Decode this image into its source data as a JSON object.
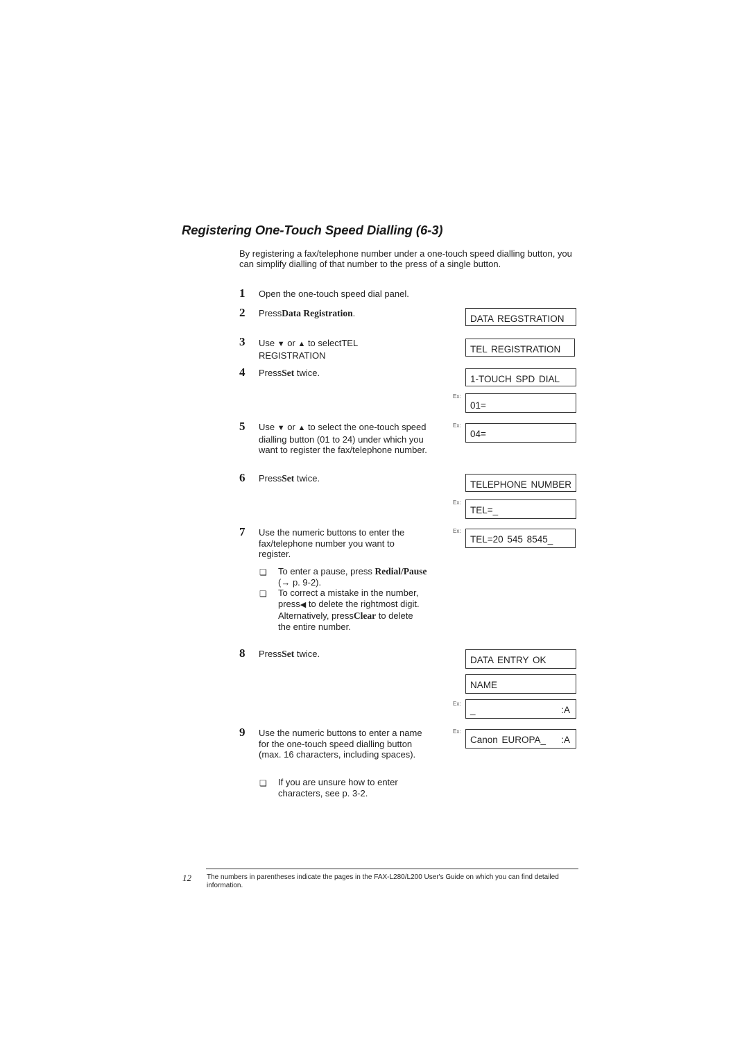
{
  "section": {
    "title": "Registering One-Touch Speed Dialling (6-3)",
    "intro": "By registering a fax/telephone number under a one-touch speed dialling button, you can simplify dialling of that number to the press of a single button."
  },
  "steps": [
    {
      "num": "1",
      "text": "Open the one-touch speed dial panel."
    },
    {
      "num": "2",
      "pre": "Press",
      "bold": "Data Registration",
      "post": "."
    },
    {
      "num": "3",
      "pre": "Use",
      "down": "▼",
      "mid": " or ",
      "up": "▲",
      "post": " to select",
      "line2a": "TEL",
      "line2b": "REGISTRATION"
    },
    {
      "num": "4",
      "pre": "Press",
      "bold": "Set",
      "post": " twice."
    },
    {
      "num": "5",
      "pre": "Use",
      "down": "▼",
      "mid": " or ",
      "up": "▲",
      "post": " to select the one-touch speed dialling button (01 to 24) under which you want to register the fax/telephone number."
    },
    {
      "num": "6",
      "pre": "Press",
      "bold": "Set",
      "post": " twice."
    },
    {
      "num": "7",
      "text": "Use the numeric buttons to enter the fax/telephone number you want to register.",
      "bullets": [
        {
          "glyph": "❏",
          "pre": "To enter a pause, press ",
          "bold": "Redial/Pause",
          "post": " (→ p. 9-2)."
        },
        {
          "glyph": "❏",
          "pre": "To correct a mistake in the number, press",
          "arrow": "◀",
          "mid": " to delete the rightmost digit. Alternatively, press",
          "bold": "Clear",
          "post": " to delete the entire number."
        }
      ]
    },
    {
      "num": "8",
      "pre": "Press",
      "bold": "Set",
      "post": " twice."
    },
    {
      "num": "9",
      "text": "Use the numeric buttons to enter a name for the one-touch speed dialling button (max. 16 characters, including spaces).",
      "bullets": [
        {
          "glyph": "❏",
          "text": "If you are unsure how to enter characters, see p. 3-2."
        }
      ]
    }
  ],
  "displays": [
    {
      "text": "DATA  REGSTRATION",
      "ex": ""
    },
    {
      "text": "TEL  REGISTRATION",
      "ex": ""
    },
    {
      "text": "1-TOUCH  SPD  DIAL",
      "ex": ""
    },
    {
      "text": "01=",
      "ex": "Ex:"
    },
    {
      "text": "04=",
      "ex": "Ex:"
    },
    {
      "text": "TELEPHONE  NUMBER",
      "ex": ""
    },
    {
      "text": "TEL=_",
      "ex": "Ex:"
    },
    {
      "text": "TEL=20  545  8545_",
      "ex": "Ex:"
    },
    {
      "text": "DATA  ENTRY  OK",
      "ex": ""
    },
    {
      "text": "NAME",
      "ex": ""
    },
    {
      "text": "_",
      "right": ":A",
      "ex": "Ex:"
    },
    {
      "text": "Canon  EUROPA_",
      "right": ":A",
      "ex": "Ex:"
    }
  ],
  "footer": {
    "page_number": "12",
    "note": "The numbers in parentheses indicate the pages in the FAX-L280/L200 User's Guide on which you can find detailed information."
  }
}
